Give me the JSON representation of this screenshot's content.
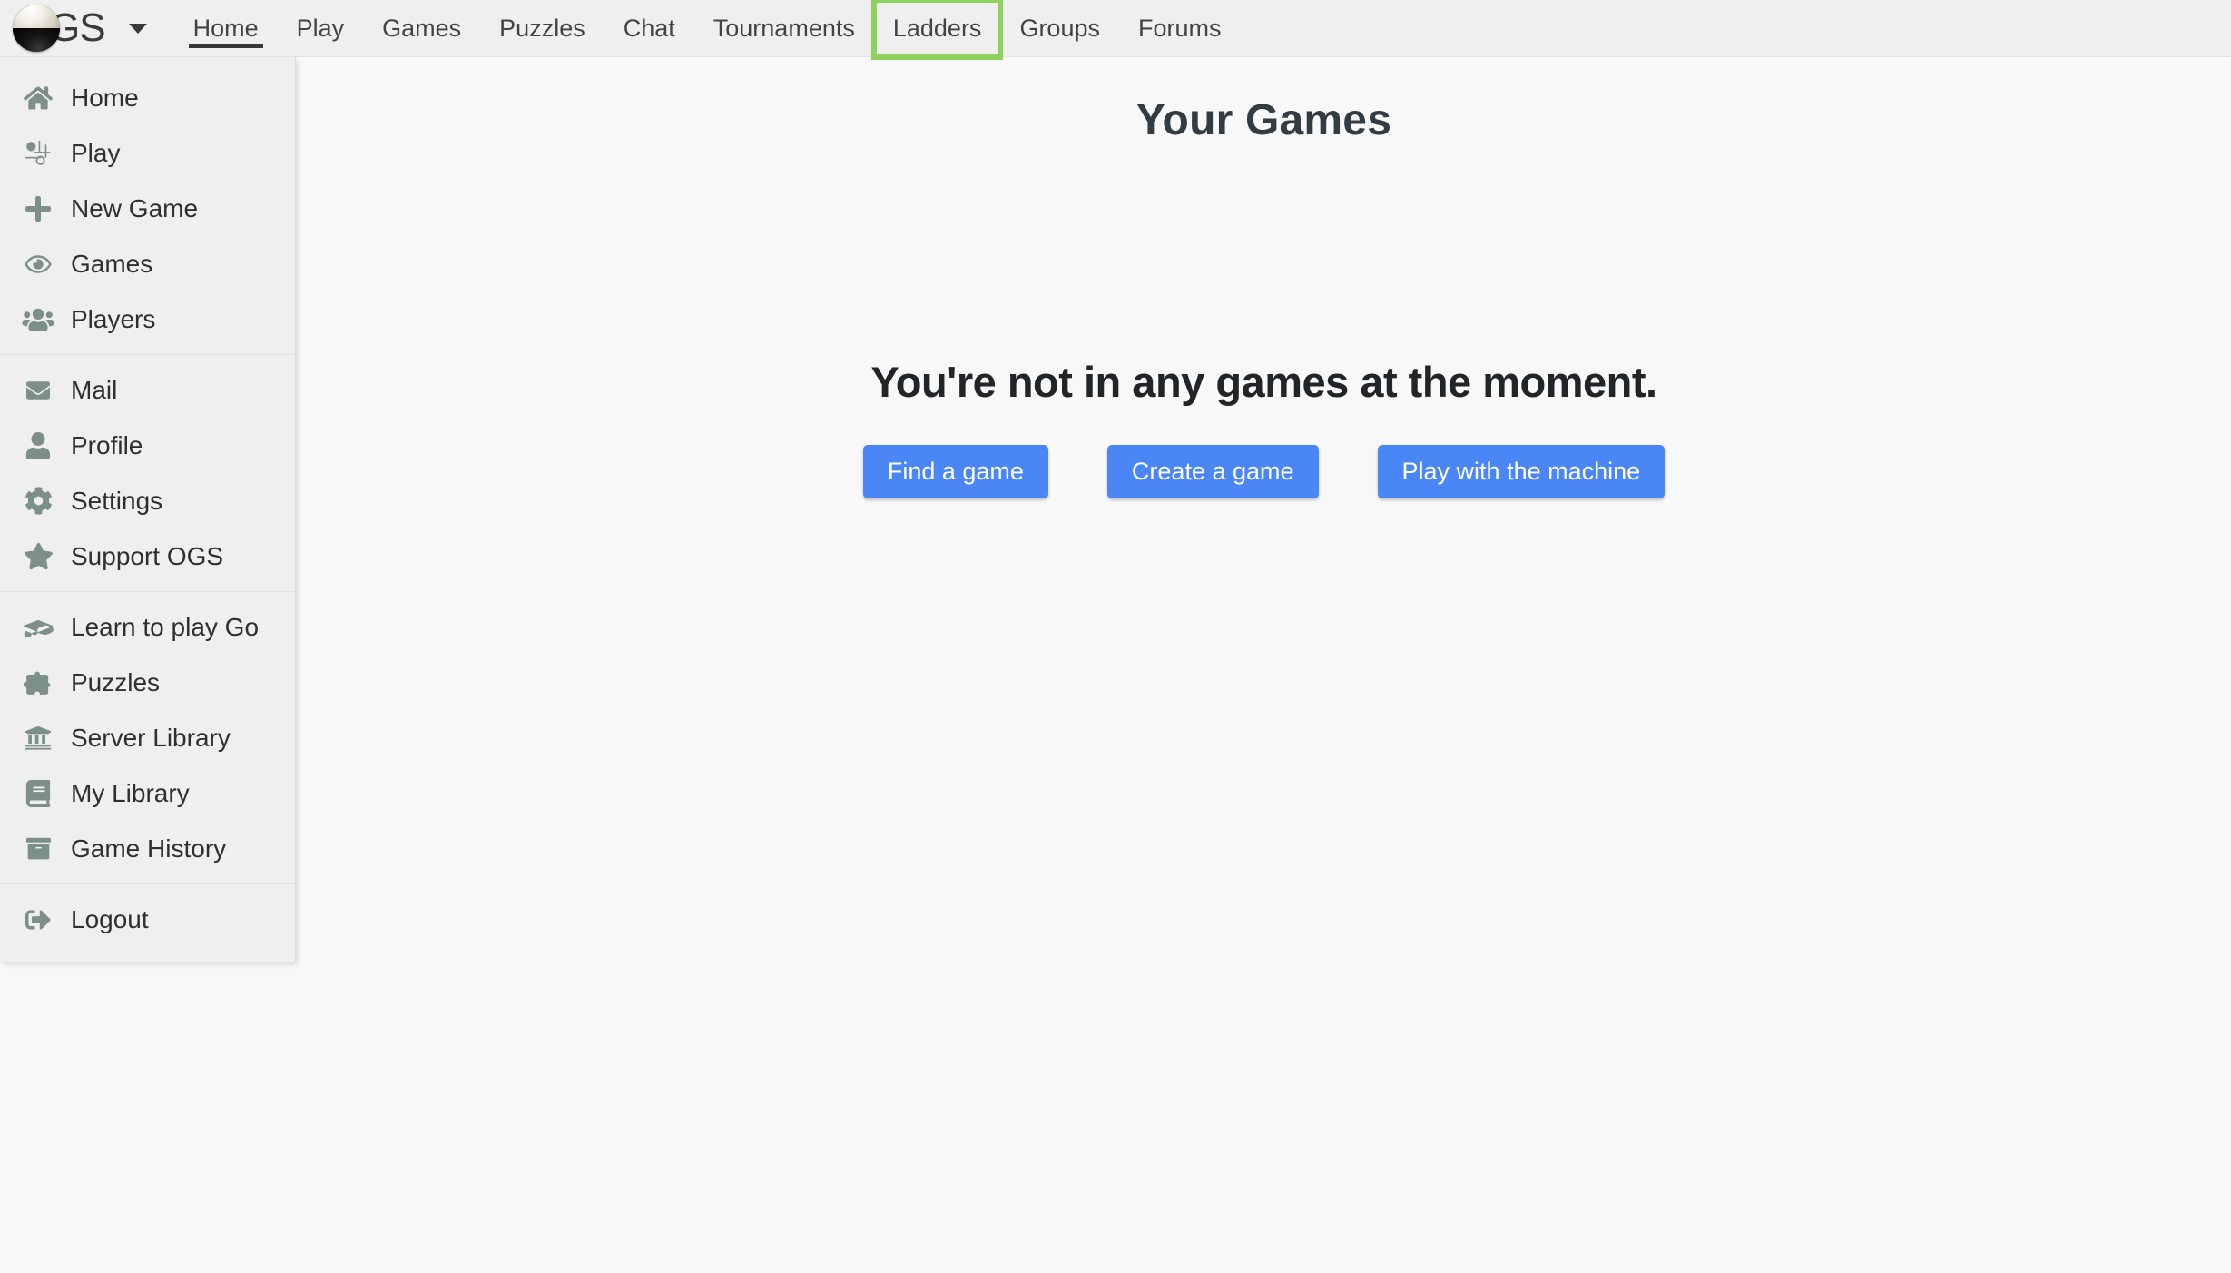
{
  "navbar": {
    "brand": {
      "logo_icon": "go-stone-icon",
      "text": "GS",
      "caret_icon": "chevron-down-icon"
    },
    "links": [
      {
        "label": "Home",
        "active": true,
        "highlighted": false
      },
      {
        "label": "Play",
        "active": false,
        "highlighted": false
      },
      {
        "label": "Games",
        "active": false,
        "highlighted": false
      },
      {
        "label": "Puzzles",
        "active": false,
        "highlighted": false
      },
      {
        "label": "Chat",
        "active": false,
        "highlighted": false
      },
      {
        "label": "Tournaments",
        "active": false,
        "highlighted": false
      },
      {
        "label": "Ladders",
        "active": false,
        "highlighted": true
      },
      {
        "label": "Groups",
        "active": false,
        "highlighted": false
      },
      {
        "label": "Forums",
        "active": false,
        "highlighted": false
      }
    ],
    "highlight_color": "#8ed15f"
  },
  "sidebar": {
    "icon_color": "#7d8f8a",
    "groups": [
      {
        "items": [
          {
            "label": "Home",
            "icon": "home-icon"
          },
          {
            "label": "Play",
            "icon": "play-goban-icon"
          },
          {
            "label": "New Game",
            "icon": "plus-icon"
          },
          {
            "label": "Games",
            "icon": "eye-icon"
          },
          {
            "label": "Players",
            "icon": "users-icon"
          }
        ]
      },
      {
        "items": [
          {
            "label": "Mail",
            "icon": "envelope-icon"
          },
          {
            "label": "Profile",
            "icon": "user-icon"
          },
          {
            "label": "Settings",
            "icon": "gear-icon"
          },
          {
            "label": "Support OGS",
            "icon": "star-icon"
          }
        ]
      },
      {
        "items": [
          {
            "label": "Learn to play Go",
            "icon": "graduation-cap-icon"
          },
          {
            "label": "Puzzles",
            "icon": "puzzle-piece-icon"
          },
          {
            "label": "Server Library",
            "icon": "bank-icon"
          },
          {
            "label": "My Library",
            "icon": "book-icon"
          },
          {
            "label": "Game History",
            "icon": "archive-icon"
          }
        ]
      },
      {
        "items": [
          {
            "label": "Logout",
            "icon": "sign-out-icon"
          }
        ]
      }
    ]
  },
  "main": {
    "title": "Your Games",
    "empty_state": {
      "message": "You're not in any games at the moment.",
      "buttons": [
        {
          "label": "Find a game"
        },
        {
          "label": "Create a game"
        },
        {
          "label": "Play with the machine"
        }
      ],
      "button_color": "#4a86f5"
    }
  }
}
